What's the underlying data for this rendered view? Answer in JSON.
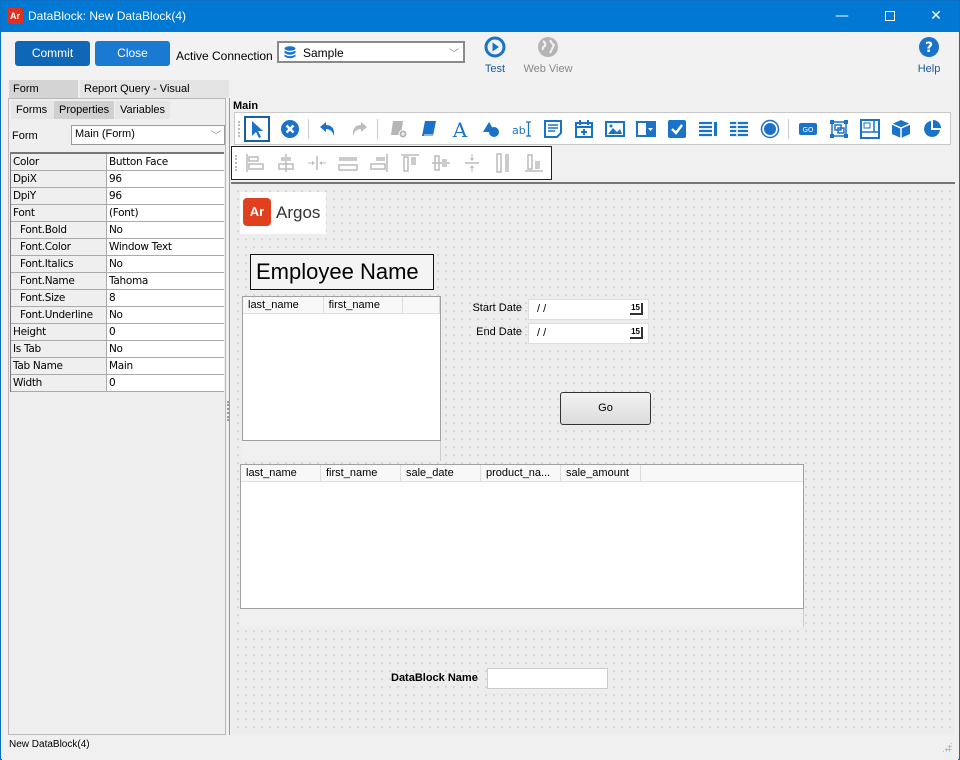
{
  "window": {
    "app_icon": "Ar",
    "title": "DataBlock: New DataBlock(4)",
    "controls": {
      "minimize": "—",
      "maximize": "□",
      "close": "✕"
    }
  },
  "topbar": {
    "commit_label": "Commit",
    "close_label": "Close",
    "active_connection_label": "Active Connection",
    "connection_value": "Sample",
    "test_label": "Test",
    "webview_label": "Web View",
    "help_label": "Help"
  },
  "colors": {
    "accent": "#0078d4",
    "button_blue": "#1a79d0",
    "icon_blue": "#1a73c8",
    "disabled_icon": "#b0b0b0",
    "argos_red": "#e0401e"
  },
  "main_tabs": [
    {
      "label": "Form Design",
      "active": true
    },
    {
      "label": "Report Query - Visual Design",
      "active": false
    }
  ],
  "left_panel": {
    "sub_tabs": [
      {
        "label": "Forms",
        "active": false
      },
      {
        "label": "Properties",
        "active": true
      },
      {
        "label": "Variables",
        "active": false
      }
    ],
    "form_label": "Form",
    "form_value": "Main (Form)",
    "properties": [
      {
        "key": "Color",
        "value": "Button Face",
        "sub": false
      },
      {
        "key": "DpiX",
        "value": "96",
        "sub": false
      },
      {
        "key": "DpiY",
        "value": "96",
        "sub": false
      },
      {
        "key": "Font",
        "value": "(Font)",
        "sub": false
      },
      {
        "key": "Font.Bold",
        "value": "No",
        "sub": true
      },
      {
        "key": "Font.Color",
        "value": "Window Text",
        "sub": true
      },
      {
        "key": "Font.Italics",
        "value": "No",
        "sub": true
      },
      {
        "key": "Font.Name",
        "value": "Tahoma",
        "sub": true
      },
      {
        "key": "Font.Size",
        "value": "8",
        "sub": true
      },
      {
        "key": "Font.Underline",
        "value": "No",
        "sub": true
      },
      {
        "key": "Height",
        "value": "0",
        "sub": false
      },
      {
        "key": "Is Tab",
        "value": "No",
        "sub": false
      },
      {
        "key": "Tab Name",
        "value": "Main",
        "sub": false
      },
      {
        "key": "Width",
        "value": "0",
        "sub": false
      }
    ]
  },
  "designer": {
    "section_label": "Main",
    "toolbar1_icons": [
      "pointer-icon",
      "delete-icon",
      "undo-icon",
      "redo-icon",
      "add-report-icon",
      "book-icon",
      "text-icon",
      "shapes-icon",
      "textbox-icon",
      "memo-icon",
      "date-icon",
      "image-icon",
      "combobox-icon",
      "checkbox-icon",
      "listbox-icon",
      "grid-icon",
      "radio-icon",
      "go-button-icon",
      "group-icon",
      "panel-icon",
      "cube-icon",
      "chart-icon"
    ],
    "toolbar2_icons": [
      "align-left-icon",
      "align-center-icon",
      "center-horizontal-icon",
      "same-width-icon",
      "align-right-icon",
      "align-top-icon",
      "align-middle-icon",
      "center-vertical-icon",
      "same-height-icon",
      "align-bottom-icon"
    ]
  },
  "form_canvas": {
    "logo_mark": "Ar",
    "logo_word": "Argos",
    "employee_title": "Employee Name",
    "grid1_columns": [
      "last_name",
      "first_name",
      ""
    ],
    "start_date_label": "Start Date",
    "start_date_value": "/ /",
    "end_date_label": "End Date",
    "end_date_value": "/ /",
    "calendar_glyph": "15",
    "go_label": "Go",
    "grid2_columns": [
      "last_name",
      "first_name",
      "sale_date",
      "product_na...",
      "sale_amount",
      ""
    ],
    "datablock_name_label": "DataBlock Name",
    "datablock_name_value": ""
  },
  "status": {
    "text": "New DataBlock(4)"
  }
}
